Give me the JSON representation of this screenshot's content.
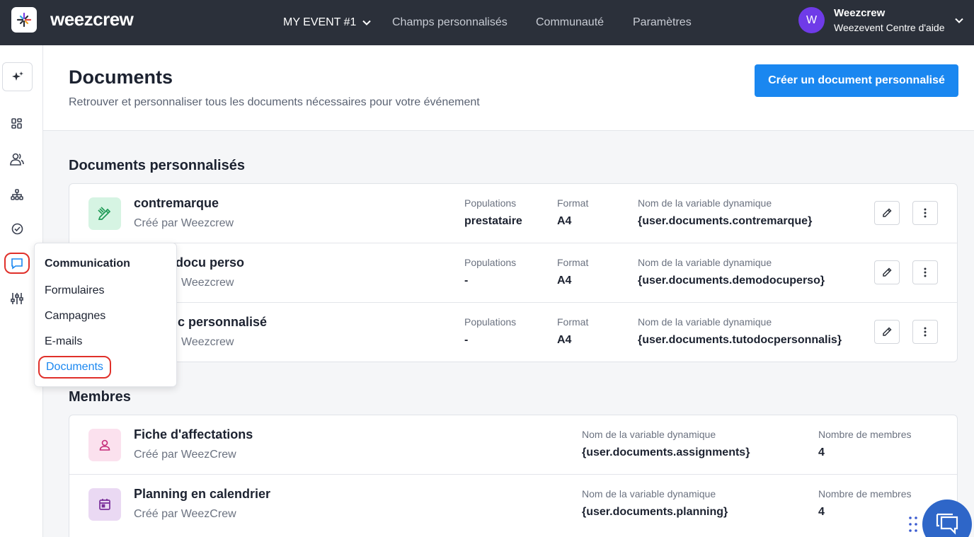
{
  "topbar": {
    "brand": "weezcrew",
    "event_selector": "MY EVENT #1",
    "nav": [
      "Champs personnalisés",
      "Communauté",
      "Paramètres"
    ],
    "user": {
      "initial": "W",
      "name": "Weezcrew",
      "organization": "Weezevent Centre d'aide"
    }
  },
  "sidebar": {
    "icons": [
      "sparkle-icon",
      "dashboard-icon",
      "users-icon",
      "org-chart-icon",
      "check-circle-icon",
      "chat-icon",
      "sliders-icon"
    ],
    "active": "chat-icon"
  },
  "header": {
    "title": "Documents",
    "subtitle": "Retrouver et personnaliser tous les documents nécessaires pour votre événement",
    "create_button": "Créer un document personnalisé"
  },
  "custom_documents": {
    "section_title": "Documents personnalisés",
    "columns": {
      "populations": "Populations",
      "format": "Format",
      "variable": "Nom de la variable dynamique"
    },
    "rows": [
      {
        "title": "contremarque",
        "subtitle": "Créé par Weezcrew",
        "populations": "prestataire",
        "format": "A4",
        "variable": "{user.documents.contremarque}"
      },
      {
        "title": "docu perso",
        "subtitle": "Weezcrew",
        "populations": "-",
        "format": "A4",
        "variable": "{user.documents.demodocuperso}"
      },
      {
        "title": "c personnalisé",
        "subtitle": "Weezcrew",
        "populations": "-",
        "format": "A4",
        "variable": "{user.documents.tutodocpersonnalis}"
      }
    ]
  },
  "members": {
    "section_title": "Membres",
    "columns": {
      "variable": "Nom de la variable dynamique",
      "count": "Nombre de membres"
    },
    "rows": [
      {
        "title": "Fiche d'affectations",
        "subtitle": "Créé par WeezCrew",
        "variable": "{user.documents.assignments}",
        "count": "4"
      },
      {
        "title": "Planning en calendrier",
        "subtitle": "Créé par WeezCrew",
        "variable": "{user.documents.planning}",
        "count": "4"
      }
    ]
  },
  "popup_menu": {
    "title": "Communication",
    "items": [
      "Formulaires",
      "Campagnes",
      "E-mails",
      "Documents"
    ],
    "active": "Documents"
  },
  "colors": {
    "topbar": "#2b303a",
    "primary": "#1a87f0",
    "avatar": "#6f3be8",
    "highlight": "#e0302a"
  }
}
